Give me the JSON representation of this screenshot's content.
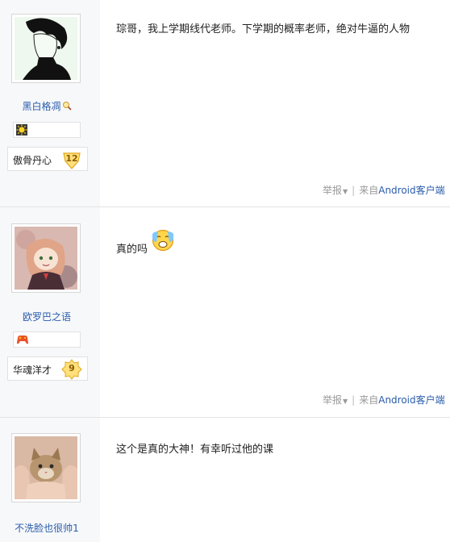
{
  "posts": [
    {
      "username": "黑白格凋",
      "rank_title": "傲骨丹心",
      "rank_level": "12",
      "content": "琮哥，我上学期线代老师。下学期的概率老师，绝对牛逼的人物",
      "report_label": "举报",
      "source_prefix": "来自",
      "source_client": "Android客户端"
    },
    {
      "username": "欧罗巴之语",
      "rank_title": "华魂洋才",
      "rank_level": "9",
      "content": "真的吗",
      "report_label": "举报",
      "source_prefix": "来自",
      "source_client": "Android客户端"
    },
    {
      "username": "不洗脸也很帅1",
      "content": "这个是真的大神！有幸听过他的课"
    }
  ],
  "icons": {
    "username_suffix": "magnifier-icon",
    "medal_post1": "sun-medal-icon",
    "medal_post2": "gamepad-medal-icon",
    "emoji_post2": "crying-emoji-icon"
  },
  "colors": {
    "link": "#2a5caa",
    "sidebar_bg": "#f7f8fa",
    "divider": "#e4e4e4",
    "muted": "#999999"
  }
}
